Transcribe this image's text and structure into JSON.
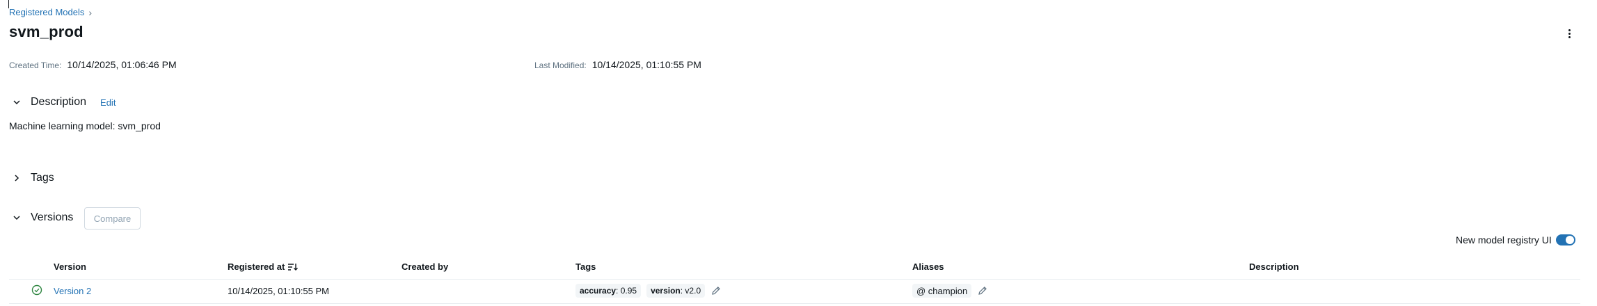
{
  "breadcrumb": {
    "parent": "Registered Models",
    "separator": "›"
  },
  "model": {
    "name": "svm_prod"
  },
  "meta": {
    "created_label": "Created Time:",
    "created_value": "10/14/2025, 01:06:46 PM",
    "modified_label": "Last Modified:",
    "modified_value": "10/14/2025, 01:10:55 PM"
  },
  "description_section": {
    "title": "Description",
    "edit_label": "Edit",
    "text": "Machine learning model: svm_prod"
  },
  "tags_section": {
    "title": "Tags"
  },
  "versions_section": {
    "title": "Versions",
    "compare_label": "Compare",
    "toggle_label": "New model registry UI",
    "toggle_on": true,
    "columns": [
      "Version",
      "Registered at",
      "Created by",
      "Tags",
      "Aliases",
      "Description"
    ],
    "rows": [
      {
        "version": "Version 2",
        "registered_at": "10/14/2025, 01:10:55 PM",
        "created_by": "",
        "tags": [
          {
            "key": "accuracy",
            "value": ": 0.95"
          },
          {
            "key": "version",
            "value": ": v2.0"
          }
        ],
        "aliases": [
          "@ champion"
        ],
        "description": ""
      }
    ]
  },
  "colors": {
    "accent": "#2272b4",
    "text": "#11171c",
    "muted": "#5f7281",
    "success": "#2e8540"
  }
}
